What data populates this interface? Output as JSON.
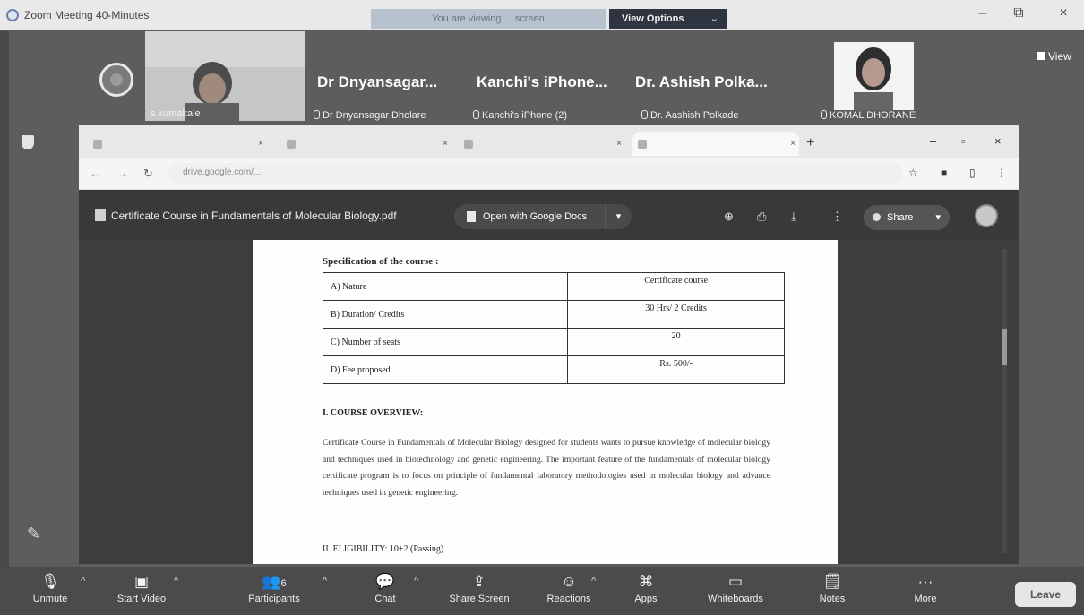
{
  "window": {
    "title": "Zoom Meeting 40-Minutes",
    "viewing_banner": "You are viewing ... screen",
    "view_options": "View Options"
  },
  "participants": {
    "tile1_label": "s.kumakale",
    "names_big": [
      "Dr Dnyansagar...",
      "Kanchi's iPhone...",
      "Dr. Ashish Polka..."
    ],
    "names_small": [
      "Dr Dnyansagar Dholare",
      "Kanchi's iPhone (2)",
      "Dr. Aashish Polkade",
      "KOMAL DHORANE"
    ]
  },
  "view_button": "View",
  "browser": {
    "url": "drive.google.com/..."
  },
  "pdf": {
    "filename": "Certificate Course in Fundamentals of Molecular Biology.pdf",
    "open_with": "Open with Google Docs",
    "share": "Share",
    "spec_title": "Specification of the course :",
    "spec_rows": [
      {
        "label": "A) Nature",
        "value": "Certificate course"
      },
      {
        "label": "B) Duration/ Credits",
        "value": "30 Hrs/ 2 Credits"
      },
      {
        "label": "C) Number of seats",
        "value": "20"
      },
      {
        "label": "D) Fee proposed",
        "value": "Rs. 500/-"
      }
    ],
    "overview_heading": "I. COURSE OVERVIEW:",
    "overview_text": "Certificate Course in Fundamentals of Molecular Biology designed for students wants to pursue knowledge of molecular biology and techniques used in biotechnology and genetic engineering. The important feature of the fundamentals of molecular biology certificate program is to focus on principle of fundamental laboratory methodologies used in molecular biology and advance techniques used in genetic engineering.",
    "eligibility": "II.  ELIGIBILITY: 10+2 (Passing)"
  },
  "toolbar": {
    "unmute": "Unmute",
    "start_video": "Start Video",
    "participants": "Participants",
    "participants_count": "6",
    "chat": "Chat",
    "share_screen": "Share Screen",
    "reactions": "Reactions",
    "apps": "Apps",
    "whiteboards": "Whiteboards",
    "notes": "Notes",
    "more": "More",
    "leave": "Leave"
  }
}
